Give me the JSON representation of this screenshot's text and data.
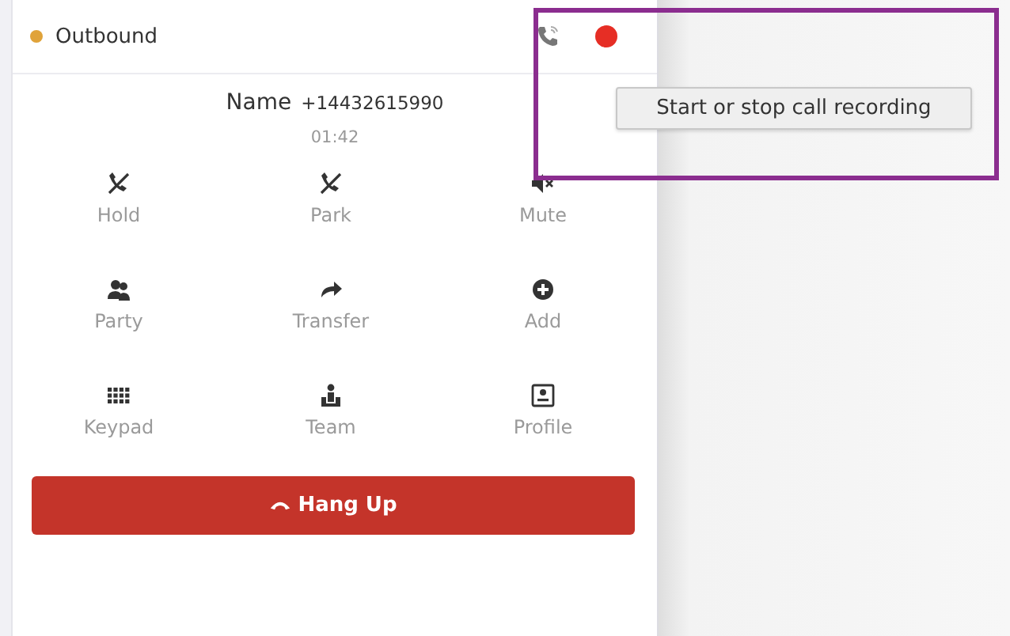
{
  "call_header": {
    "status": {
      "label": "Outbound",
      "color": "#e0a33a"
    },
    "recording": {
      "on": true
    }
  },
  "caller": {
    "name": "Name",
    "number": "+14432615990",
    "duration": "01:42"
  },
  "actions": [
    {
      "kind": "hold",
      "label": "Hold"
    },
    {
      "kind": "park",
      "label": "Park"
    },
    {
      "kind": "mute",
      "label": "Mute"
    },
    {
      "kind": "party",
      "label": "Party"
    },
    {
      "kind": "transfer",
      "label": "Transfer"
    },
    {
      "kind": "add",
      "label": "Add"
    },
    {
      "kind": "keypad",
      "label": "Keypad"
    },
    {
      "kind": "team",
      "label": "Team"
    },
    {
      "kind": "profile",
      "label": "Profile"
    }
  ],
  "hang_up": {
    "label": "Hang Up"
  },
  "tooltip": {
    "text": "Start or stop call recording"
  }
}
